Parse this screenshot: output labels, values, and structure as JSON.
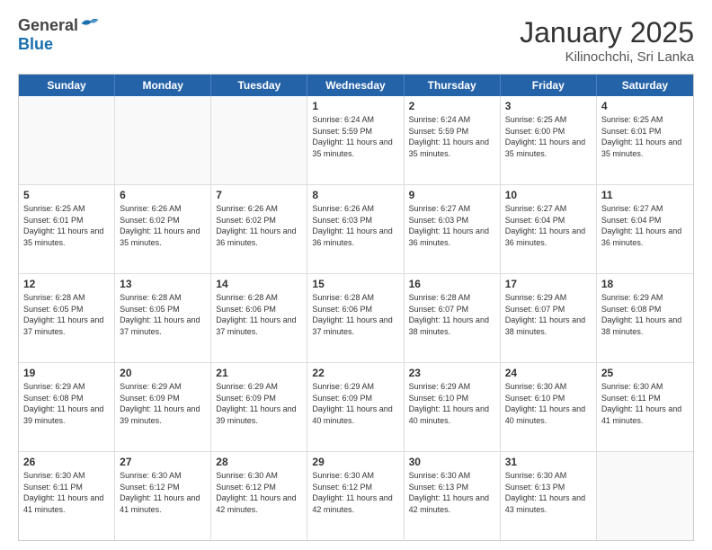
{
  "header": {
    "logo_general": "General",
    "logo_blue": "Blue",
    "month": "January 2025",
    "location": "Kilinochchi, Sri Lanka"
  },
  "days_of_week": [
    "Sunday",
    "Monday",
    "Tuesday",
    "Wednesday",
    "Thursday",
    "Friday",
    "Saturday"
  ],
  "weeks": [
    [
      {
        "day": "",
        "text": ""
      },
      {
        "day": "",
        "text": ""
      },
      {
        "day": "",
        "text": ""
      },
      {
        "day": "1",
        "text": "Sunrise: 6:24 AM\nSunset: 5:59 PM\nDaylight: 11 hours and 35 minutes."
      },
      {
        "day": "2",
        "text": "Sunrise: 6:24 AM\nSunset: 5:59 PM\nDaylight: 11 hours and 35 minutes."
      },
      {
        "day": "3",
        "text": "Sunrise: 6:25 AM\nSunset: 6:00 PM\nDaylight: 11 hours and 35 minutes."
      },
      {
        "day": "4",
        "text": "Sunrise: 6:25 AM\nSunset: 6:01 PM\nDaylight: 11 hours and 35 minutes."
      }
    ],
    [
      {
        "day": "5",
        "text": "Sunrise: 6:25 AM\nSunset: 6:01 PM\nDaylight: 11 hours and 35 minutes."
      },
      {
        "day": "6",
        "text": "Sunrise: 6:26 AM\nSunset: 6:02 PM\nDaylight: 11 hours and 35 minutes."
      },
      {
        "day": "7",
        "text": "Sunrise: 6:26 AM\nSunset: 6:02 PM\nDaylight: 11 hours and 36 minutes."
      },
      {
        "day": "8",
        "text": "Sunrise: 6:26 AM\nSunset: 6:03 PM\nDaylight: 11 hours and 36 minutes."
      },
      {
        "day": "9",
        "text": "Sunrise: 6:27 AM\nSunset: 6:03 PM\nDaylight: 11 hours and 36 minutes."
      },
      {
        "day": "10",
        "text": "Sunrise: 6:27 AM\nSunset: 6:04 PM\nDaylight: 11 hours and 36 minutes."
      },
      {
        "day": "11",
        "text": "Sunrise: 6:27 AM\nSunset: 6:04 PM\nDaylight: 11 hours and 36 minutes."
      }
    ],
    [
      {
        "day": "12",
        "text": "Sunrise: 6:28 AM\nSunset: 6:05 PM\nDaylight: 11 hours and 37 minutes."
      },
      {
        "day": "13",
        "text": "Sunrise: 6:28 AM\nSunset: 6:05 PM\nDaylight: 11 hours and 37 minutes."
      },
      {
        "day": "14",
        "text": "Sunrise: 6:28 AM\nSunset: 6:06 PM\nDaylight: 11 hours and 37 minutes."
      },
      {
        "day": "15",
        "text": "Sunrise: 6:28 AM\nSunset: 6:06 PM\nDaylight: 11 hours and 37 minutes."
      },
      {
        "day": "16",
        "text": "Sunrise: 6:28 AM\nSunset: 6:07 PM\nDaylight: 11 hours and 38 minutes."
      },
      {
        "day": "17",
        "text": "Sunrise: 6:29 AM\nSunset: 6:07 PM\nDaylight: 11 hours and 38 minutes."
      },
      {
        "day": "18",
        "text": "Sunrise: 6:29 AM\nSunset: 6:08 PM\nDaylight: 11 hours and 38 minutes."
      }
    ],
    [
      {
        "day": "19",
        "text": "Sunrise: 6:29 AM\nSunset: 6:08 PM\nDaylight: 11 hours and 39 minutes."
      },
      {
        "day": "20",
        "text": "Sunrise: 6:29 AM\nSunset: 6:09 PM\nDaylight: 11 hours and 39 minutes."
      },
      {
        "day": "21",
        "text": "Sunrise: 6:29 AM\nSunset: 6:09 PM\nDaylight: 11 hours and 39 minutes."
      },
      {
        "day": "22",
        "text": "Sunrise: 6:29 AM\nSunset: 6:09 PM\nDaylight: 11 hours and 40 minutes."
      },
      {
        "day": "23",
        "text": "Sunrise: 6:29 AM\nSunset: 6:10 PM\nDaylight: 11 hours and 40 minutes."
      },
      {
        "day": "24",
        "text": "Sunrise: 6:30 AM\nSunset: 6:10 PM\nDaylight: 11 hours and 40 minutes."
      },
      {
        "day": "25",
        "text": "Sunrise: 6:30 AM\nSunset: 6:11 PM\nDaylight: 11 hours and 41 minutes."
      }
    ],
    [
      {
        "day": "26",
        "text": "Sunrise: 6:30 AM\nSunset: 6:11 PM\nDaylight: 11 hours and 41 minutes."
      },
      {
        "day": "27",
        "text": "Sunrise: 6:30 AM\nSunset: 6:12 PM\nDaylight: 11 hours and 41 minutes."
      },
      {
        "day": "28",
        "text": "Sunrise: 6:30 AM\nSunset: 6:12 PM\nDaylight: 11 hours and 42 minutes."
      },
      {
        "day": "29",
        "text": "Sunrise: 6:30 AM\nSunset: 6:12 PM\nDaylight: 11 hours and 42 minutes."
      },
      {
        "day": "30",
        "text": "Sunrise: 6:30 AM\nSunset: 6:13 PM\nDaylight: 11 hours and 42 minutes."
      },
      {
        "day": "31",
        "text": "Sunrise: 6:30 AM\nSunset: 6:13 PM\nDaylight: 11 hours and 43 minutes."
      },
      {
        "day": "",
        "text": ""
      }
    ]
  ]
}
